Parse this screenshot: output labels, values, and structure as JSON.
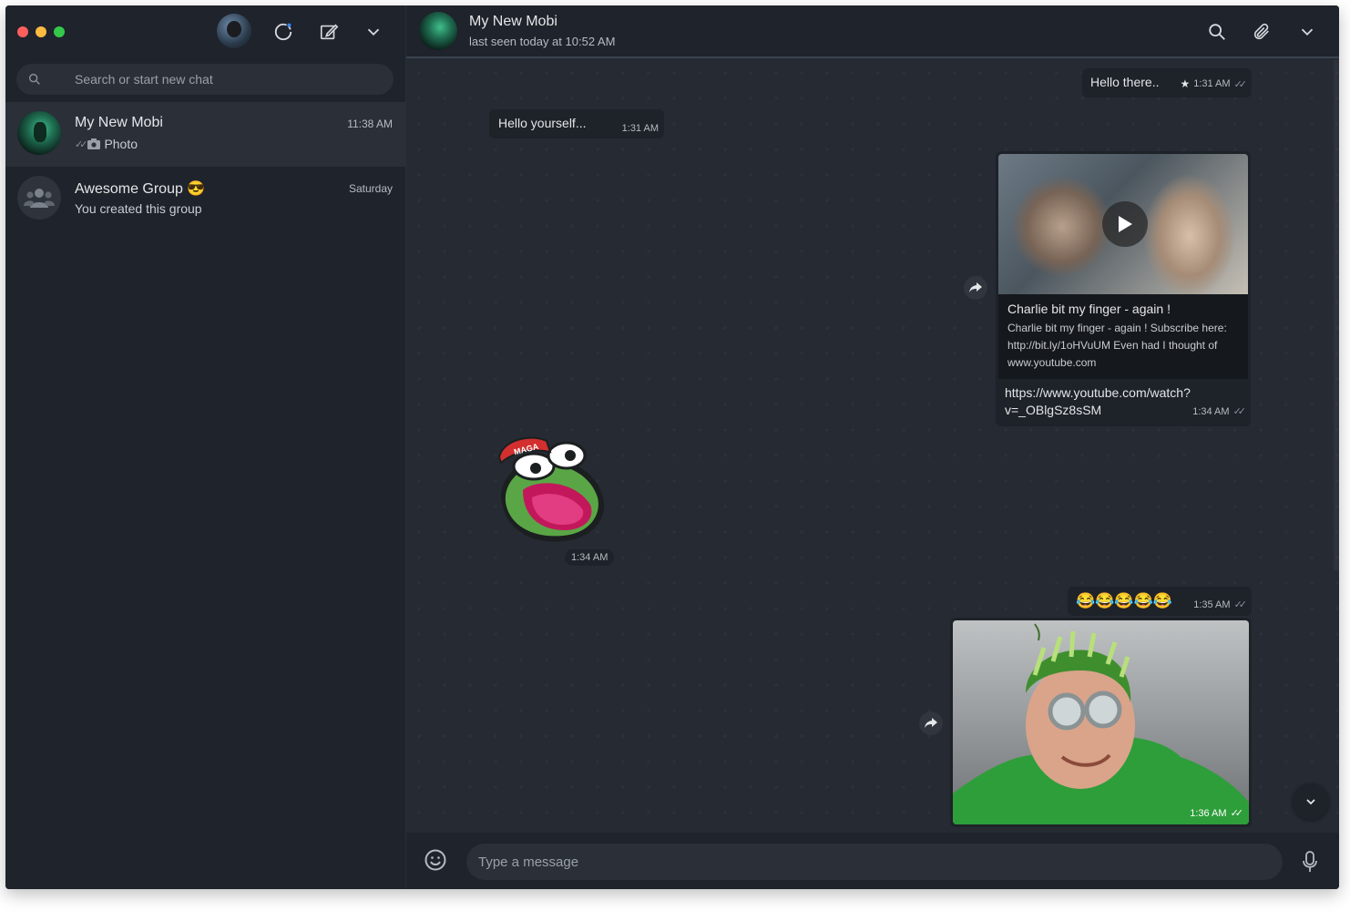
{
  "sidebar": {
    "search_placeholder": "Search or start new chat",
    "chats": [
      {
        "name": "My New Mobi",
        "time": "11:38 AM",
        "preview": "Photo",
        "active": true
      },
      {
        "name": "Awesome Group",
        "name_emoji": "😎",
        "time": "Saturday",
        "preview": "You created this group",
        "active": false
      }
    ]
  },
  "conversation": {
    "contact_name": "My New Mobi",
    "contact_status": "last seen today at 10:52 AM",
    "messages": [
      {
        "direction": "out",
        "text": "Hello there..",
        "time": "1:31 AM",
        "starred": true
      },
      {
        "direction": "in",
        "text": "Hello yourself...",
        "time": "1:31 AM"
      },
      {
        "direction": "out",
        "type": "link",
        "preview_title": "Charlie bit my finger - again !",
        "preview_desc": "Charlie bit my finger - again ! Subscribe here: http://bit.ly/1oHVuUM Even had I thought of",
        "preview_domain": "www.youtube.com",
        "link": "https://www.youtube.com/watch?v=_OBlgSz8sSM",
        "time": "1:34 AM"
      },
      {
        "direction": "in",
        "type": "sticker",
        "sticker_text": "MAGA",
        "time": "1:34 AM"
      },
      {
        "direction": "out",
        "text": "😂😂😂😂😂",
        "time": "1:35 AM"
      },
      {
        "direction": "out",
        "type": "photo",
        "time": "1:36 AM"
      }
    ],
    "composer_placeholder": "Type a message"
  },
  "colors": {
    "window_bg": "#1f232b",
    "chat_bg": "#262a32",
    "bubble_bg": "#1e2229",
    "active_item": "#2a2f38",
    "text_primary": "#e4e6e8",
    "text_secondary": "#b7bbc1"
  },
  "icons": {
    "window_controls": [
      "close",
      "minimize",
      "zoom"
    ],
    "header": [
      "status-icon",
      "new-chat-icon",
      "chevron-down-icon"
    ],
    "chat_header": [
      "search-icon",
      "paperclip-icon",
      "chevron-down-icon"
    ]
  }
}
